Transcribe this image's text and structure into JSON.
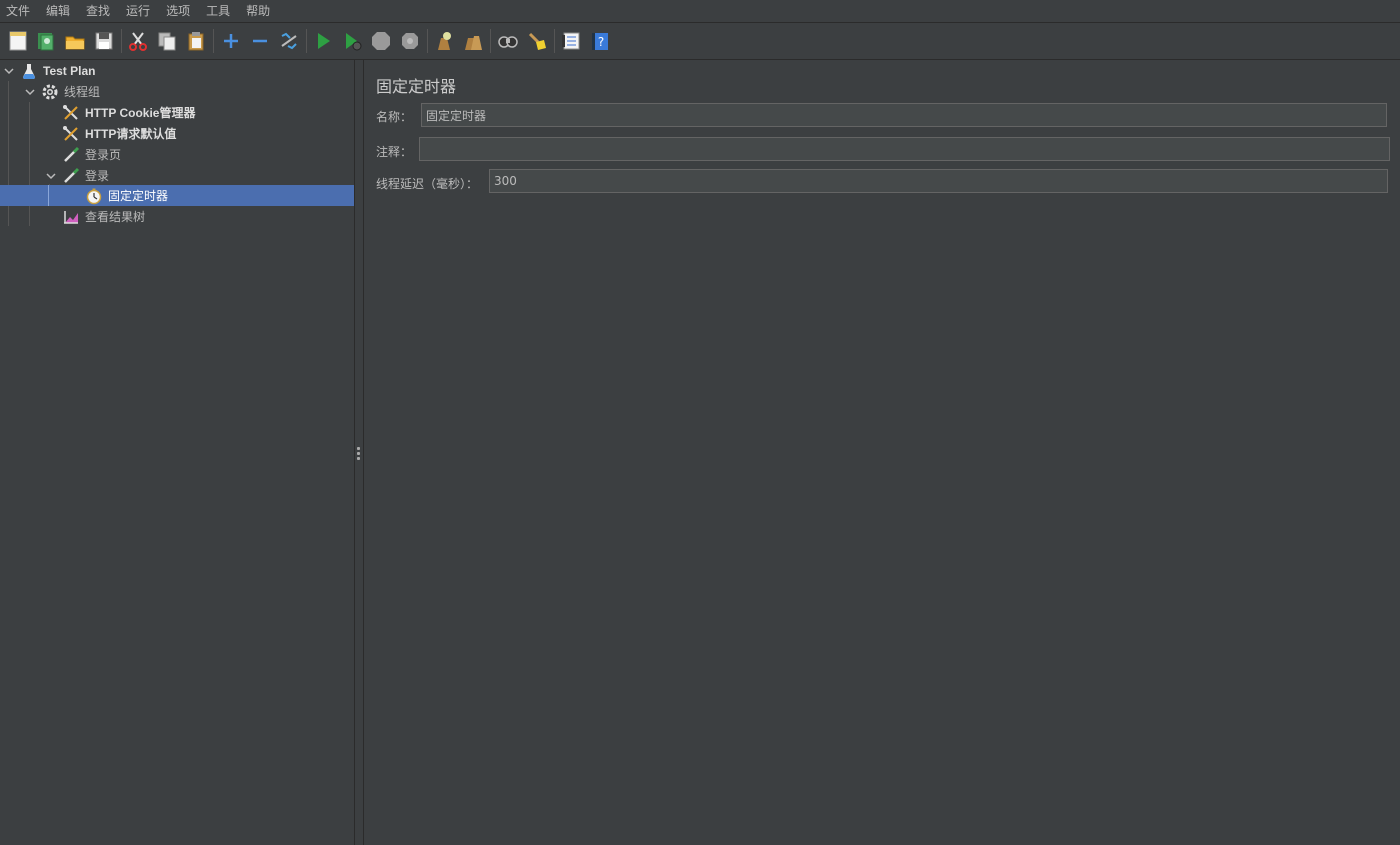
{
  "menu": [
    "文件",
    "编辑",
    "查找",
    "运行",
    "选项",
    "工具",
    "帮助"
  ],
  "toolbar": {
    "buttons": [
      "new-icon",
      "templates-icon",
      "open-icon",
      "save-icon",
      "cut-icon",
      "copy-icon",
      "paste-icon",
      "expand-icon",
      "collapse-icon",
      "toggle-icon",
      "start-icon",
      "start-no-pause-icon",
      "stop-icon",
      "shutdown-icon",
      "clear-icon",
      "clear-all-icon",
      "search-icon",
      "reset-search-icon",
      "function-helper-icon",
      "help-icon"
    ]
  },
  "tree": {
    "items": [
      {
        "label": "Test Plan",
        "icon": "test-plan-icon"
      },
      {
        "label": "线程组",
        "icon": "thread-group-icon"
      },
      {
        "label": "HTTP Cookie管理器",
        "icon": "config-tool-icon"
      },
      {
        "label": "HTTP请求默认值",
        "icon": "config-tool-icon"
      },
      {
        "label": "登录页",
        "icon": "sampler-pipette-icon"
      },
      {
        "label": "登录",
        "icon": "sampler-pipette-icon"
      },
      {
        "label": "固定定时器",
        "icon": "timer-icon"
      },
      {
        "label": "查看结果树",
        "icon": "listener-chart-icon"
      }
    ],
    "selected": "固定定时器"
  },
  "panel": {
    "title": "固定定时器",
    "name_label": "名称：",
    "name_value": "固定定时器",
    "comment_label": "注释：",
    "comment_value": "",
    "delay_label": "线程延迟（毫秒）：",
    "delay_value": "300"
  },
  "colors": {
    "background": "#3c3f41",
    "selection": "#4b6eaf",
    "input_bg": "#45494a",
    "text": "#bbbbbb"
  }
}
